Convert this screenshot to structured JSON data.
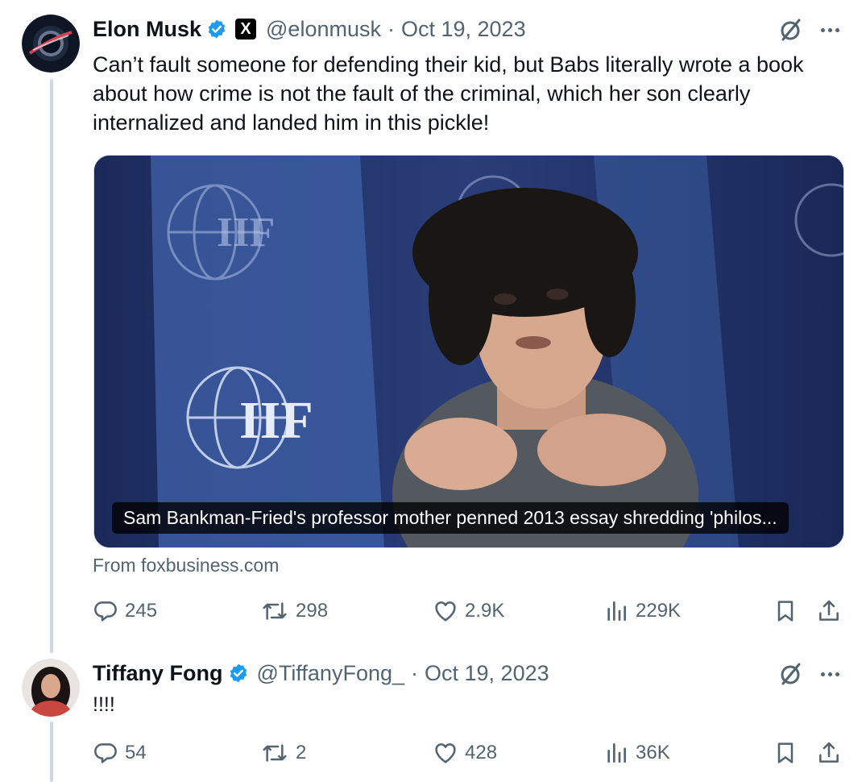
{
  "tweets": [
    {
      "author_name": "Elon Musk",
      "affiliation_badge": "X",
      "handle": "@elonmusk",
      "separator": "·",
      "date": "Oct 19, 2023",
      "text": "Can’t fault someone for defending their kid, but Babs literally wrote a book about how crime is not the fault of the criminal, which her son clearly internalized and landed him in this pickle!",
      "card": {
        "caption": "Sam Bankman-Fried's professor mother penned 2013 essay shredding 'philos...",
        "source": "From foxbusiness.com"
      },
      "stats": {
        "replies": "245",
        "reposts": "298",
        "likes": "2.9K",
        "views": "229K"
      }
    },
    {
      "author_name": "Tiffany Fong",
      "handle": "@TiffanyFong_",
      "separator": "·",
      "date": "Oct 19, 2023",
      "text": "!!!!",
      "stats": {
        "replies": "54",
        "reposts": "2",
        "likes": "428",
        "views": "36K"
      }
    }
  ],
  "colors": {
    "verified": "#1d9bf0",
    "secondary_text": "#536471",
    "thread_line": "#cfd9de"
  },
  "icons": [
    "reply-icon",
    "repost-icon",
    "like-icon",
    "views-icon",
    "bookmark-icon",
    "share-icon",
    "grok-icon",
    "more-icon",
    "verified-icon"
  ]
}
